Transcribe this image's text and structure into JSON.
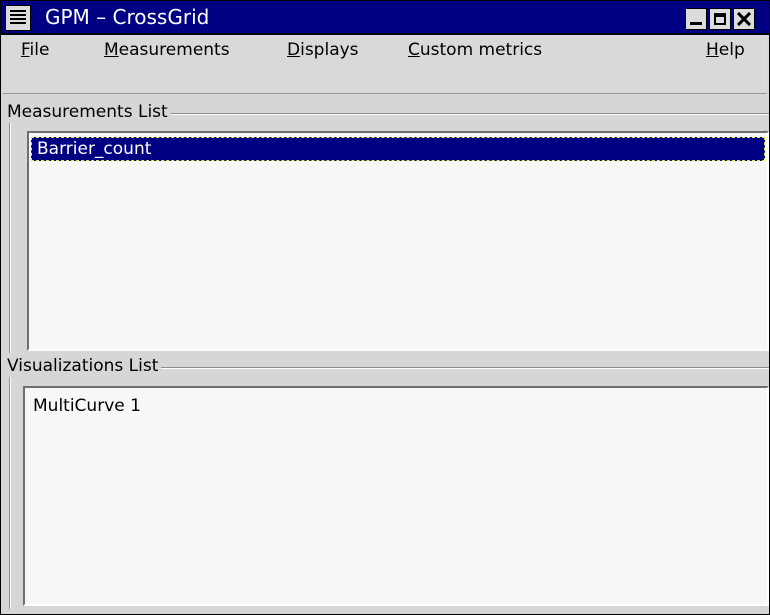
{
  "window": {
    "title": "GPM – CrossGrid"
  },
  "menubar": {
    "items": [
      "File",
      "Measurements",
      "Displays",
      "Custom metrics",
      "Help"
    ]
  },
  "measurements": {
    "label": "Measurements List",
    "items": [
      "Barrier_count"
    ],
    "selected_index": 0
  },
  "visualizations": {
    "label": "Visualizations List",
    "items": [
      "MultiCurve 1"
    ]
  },
  "colors": {
    "title_bar": "#000082",
    "selection": "#000082",
    "list_bg": "#f5f8f5",
    "chrome": "#d6d6d6"
  }
}
